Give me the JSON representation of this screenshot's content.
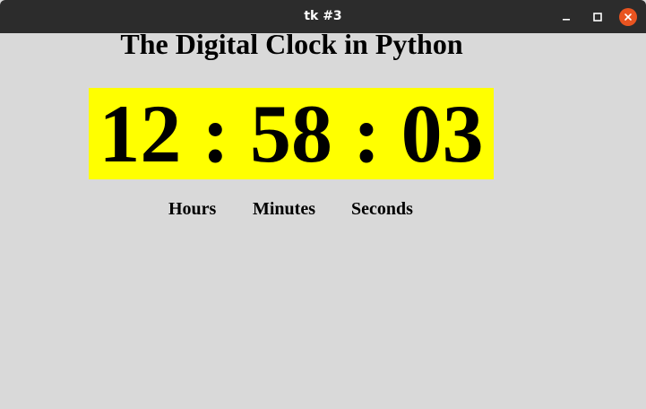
{
  "window": {
    "title": "tk #3",
    "close_color": "#e95420"
  },
  "app": {
    "heading": "The Digital Clock in Python",
    "clock": {
      "hours": "12",
      "separator1": " : ",
      "minutes": "58",
      "separator2": " : ",
      "seconds": "03",
      "background_color": "#ffff00"
    },
    "labels": {
      "hours": "Hours",
      "minutes": "Minutes",
      "seconds": "Seconds"
    }
  },
  "icons": {
    "minimize": "minimize-icon",
    "maximize": "maximize-icon",
    "close": "close-icon"
  }
}
